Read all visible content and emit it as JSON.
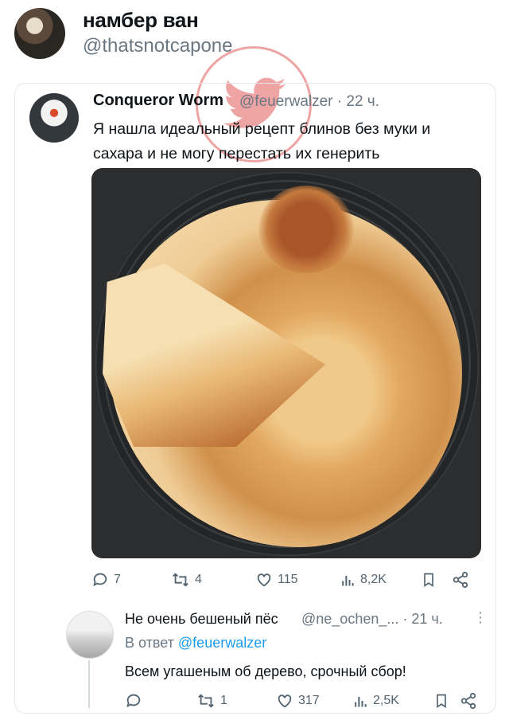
{
  "header": {
    "display_name": "намбер ван",
    "handle": "@thatsnotcapone"
  },
  "quoted_tweet": {
    "author_name": "Conqueror Worm",
    "author_meta": "@feuerwalzer · 22 ч.",
    "text": "Я нашла идеальный рецепт блинов без муки и сахара и не могу перестать их генерить",
    "actions": {
      "replies": "7",
      "retweets": "4",
      "likes": "115",
      "views": "8,2K"
    }
  },
  "reply": {
    "author_name": "Не очень бешеный пёс",
    "author_meta": "@ne_ochen_... · 21 ч.",
    "more": "⋮",
    "reply_to_prefix": "В ответ",
    "reply_to_handle": "@feuerwalzer",
    "text": "Всем угашеным об дерево, срочный сбор!",
    "actions": {
      "replies": "",
      "retweets": "1",
      "likes": "317",
      "views": "2,5K"
    }
  },
  "icons": [
    "reply-icon",
    "retweet-icon",
    "like-icon",
    "views-icon",
    "bookmark-icon",
    "share-icon"
  ],
  "colors": {
    "text": "#0f1419",
    "muted": "#6b7782",
    "link": "#1d9bf0",
    "watermark": "#e25a5a"
  }
}
